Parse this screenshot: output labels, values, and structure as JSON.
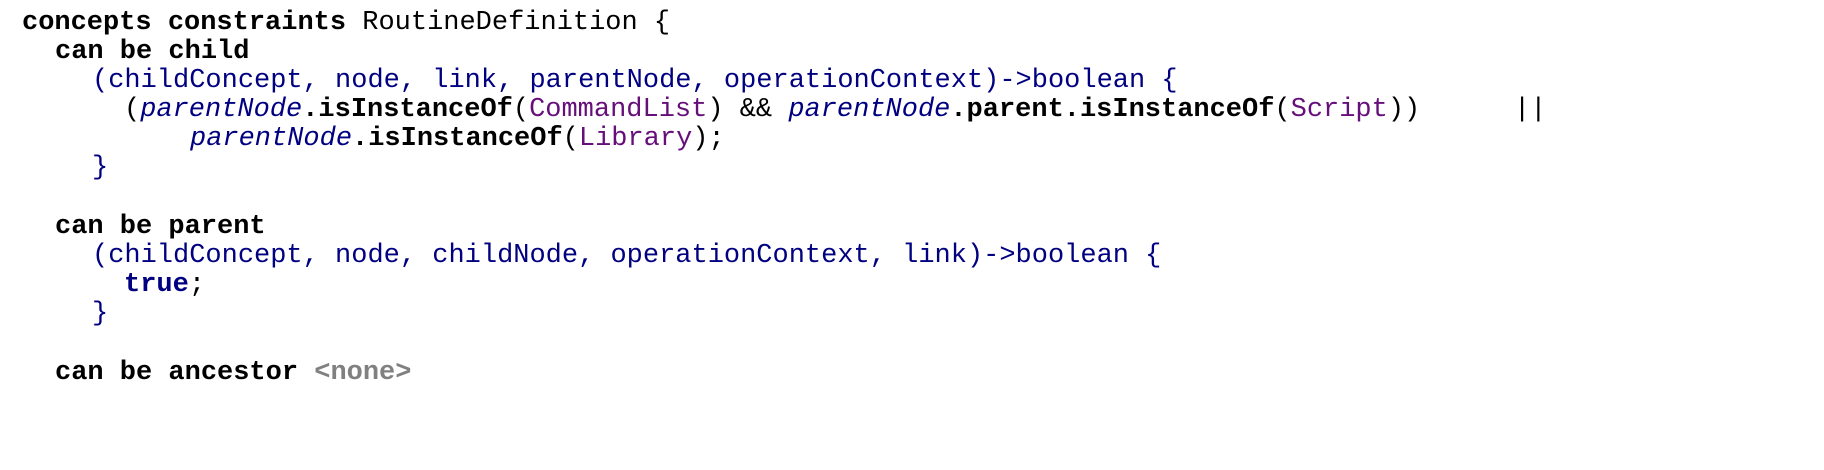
{
  "code": {
    "header": {
      "keyword": "concepts constraints",
      "name": "RoutineDefinition",
      "open_brace": "{"
    },
    "can_be_child": {
      "label": "can be child",
      "signature": "(childConcept, node, link, parentNode, operationContext)->boolean {",
      "body_open_paren": "(",
      "var1": "parentNode",
      "method1": ".isInstanceOf",
      "arg1_open": "(",
      "arg1": "CommandList",
      "arg1_close": ")",
      "and_op": " && ",
      "var2": "parentNode",
      "prop_parent": ".parent",
      "method2": ".isInstanceOf",
      "arg2_open": "(",
      "arg2": "Script",
      "arg2_close": "))",
      "or_op": "||",
      "var3": "parentNode",
      "method3": ".isInstanceOf",
      "arg3_open": "(",
      "arg3": "Library",
      "arg3_close": ");",
      "close_brace": "}"
    },
    "can_be_parent": {
      "label": "can be parent",
      "signature": "(childConcept, node, childNode, operationContext, link)->boolean {",
      "body_keyword": "true",
      "body_semicolon": ";",
      "close_brace": "}"
    },
    "can_be_ancestor": {
      "label": "can be ancestor",
      "value": "<none>"
    }
  }
}
